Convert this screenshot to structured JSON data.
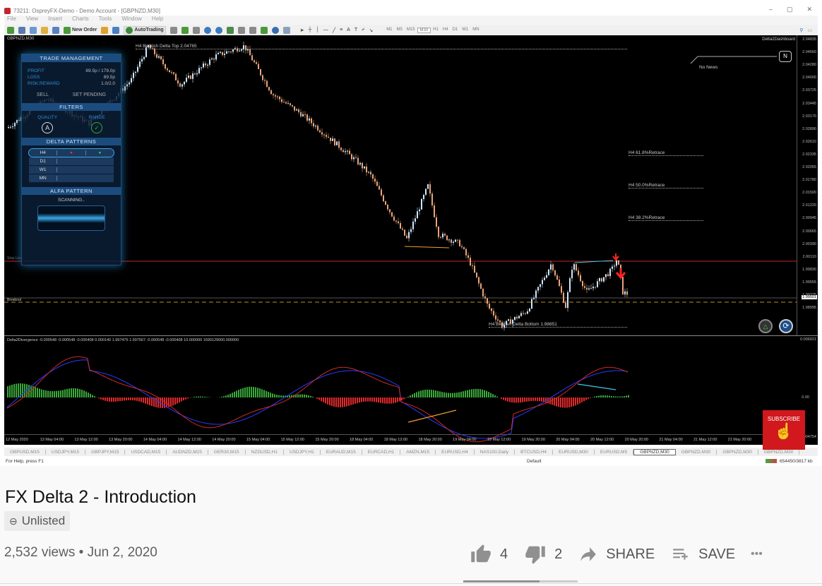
{
  "window": {
    "title": "73211: OspreyFX-Demo - Demo Account - [GBPNZD,M30]",
    "controls": [
      "–",
      "▢",
      "✕"
    ]
  },
  "menu": [
    "File",
    "View",
    "Insert",
    "Charts",
    "Tools",
    "Window",
    "Help"
  ],
  "toolbar": {
    "new_order": "New Order",
    "autotrading": "AutoTrading",
    "timeframes": [
      "M1",
      "M5",
      "M15",
      "M30",
      "H1",
      "H4",
      "D1",
      "W1",
      "MN"
    ],
    "active_timeframe": "M30"
  },
  "chart": {
    "symbol": "GBPNZD,M30",
    "dashboard": "Delta2Dashboard",
    "news": "No News",
    "news_badge": "N",
    "top_label": "H4 Bearish Delta Top 2.04765",
    "bottom_label": "H4 Bearish Delta Bottom 1.98851",
    "retraces": [
      "H4  61.8%Retrace",
      "H4  50.0%Retrace",
      "H4  38.2%Retrace"
    ],
    "sl_label": "Stop Loss",
    "breakout_label": "Breakout",
    "current_price": "1.99501",
    "price_ticks": [
      "2.04835",
      "2.04560",
      "2.04280",
      "2.04000",
      "2.03725",
      "2.03445",
      "2.03170",
      "2.02890",
      "2.02610",
      "2.02335",
      "2.02055",
      "2.01780",
      "2.01500",
      "2.01220",
      "2.00945",
      "2.00665",
      "2.00390",
      "2.00110",
      "1.99830",
      "1.99555",
      "1.99275",
      "1.98995"
    ],
    "colors": {
      "bull": "#cfe8ff",
      "bear": "#e8a57a",
      "sl_line": "#c0282d",
      "breakout": "#b8902a",
      "divergence": "#f0a030"
    }
  },
  "panel": {
    "trade_management": "TRADE MANAGEMENT",
    "rows": [
      {
        "k": "PROFIT",
        "v": "89.5p / 179.0p"
      },
      {
        "k": "LOSS",
        "v": "89.5p"
      },
      {
        "k": "RISK:REWARD",
        "v": "1.0/2.0"
      }
    ],
    "sell": "SELL",
    "set_pending": "SET PENDING",
    "filters": "FILTERS",
    "quality": "QUALITY",
    "quality_value": "A",
    "range": "RANGE",
    "range_value": "✓",
    "delta_patterns": "DELTA PATTERNS",
    "pattern_rows": [
      "H4",
      "D1",
      "W1",
      "MN"
    ],
    "alfa_pattern": "ALFA PATTERN",
    "scanning": "SCANNING.."
  },
  "oscillator": {
    "label": "Delta2Divergence -0.000548 -0.000548 -0.000408 0.000140 1.997475 1.997567 -0.000548 -0.000408 10.000000 1590129000.000000",
    "ticks": [
      "0.006921",
      "0.00",
      "-0.004754"
    ]
  },
  "time_axis": [
    "12 May 2020",
    "13 May 04:00",
    "13 May 12:00",
    "13 May 20:00",
    "14 May 04:00",
    "14 May 12:00",
    "14 May 20:00",
    "15 May 04:00",
    "15 May 12:00",
    "15 May 20:00",
    "18 May 04:00",
    "18 May 12:00",
    "18 May 20:00",
    "19 May 04:00",
    "19 May 12:00",
    "19 May 20:00",
    "20 May 04:00",
    "20 May 12:00",
    "20 May 20:00",
    "21 May 04:00",
    "21 May 12:00",
    "21 May 20:00",
    "22 May 04:00"
  ],
  "tabs": [
    "GBPUSD,M15",
    "USDJPY,M15",
    "GBPJPY,M15",
    "USDCAD,M15",
    "AUDNZD,M15",
    "GER30,M15",
    "NZDUSD,H1",
    "USDJPY,H1",
    "EURAUD,M15",
    "EURCAD,H1",
    "AMZN,M15",
    "EURUSD,H4",
    "NAS100,Daily",
    "BTCUSD,H4",
    "EURUSD,M30",
    "EURUSD,M5",
    "GBPNZD,M30",
    "GBPNZD,M30",
    "GBPNZD,M30",
    "GBPNZD,M30"
  ],
  "active_tab": 16,
  "status": {
    "help": "For Help, press F1",
    "profile": "Default",
    "traffic": "654450/3817 kb"
  },
  "subscribe": "SUBSCRIBE",
  "video": {
    "title": "FX Delta 2 - Introduction",
    "visibility": "Unlisted",
    "views": "2,532 views",
    "dot": "•",
    "date": "Jun 2, 2020",
    "likes": "4",
    "dislikes": "2",
    "share": "SHARE",
    "save": "SAVE",
    "more": "•••",
    "like_ratio": 0.667
  }
}
